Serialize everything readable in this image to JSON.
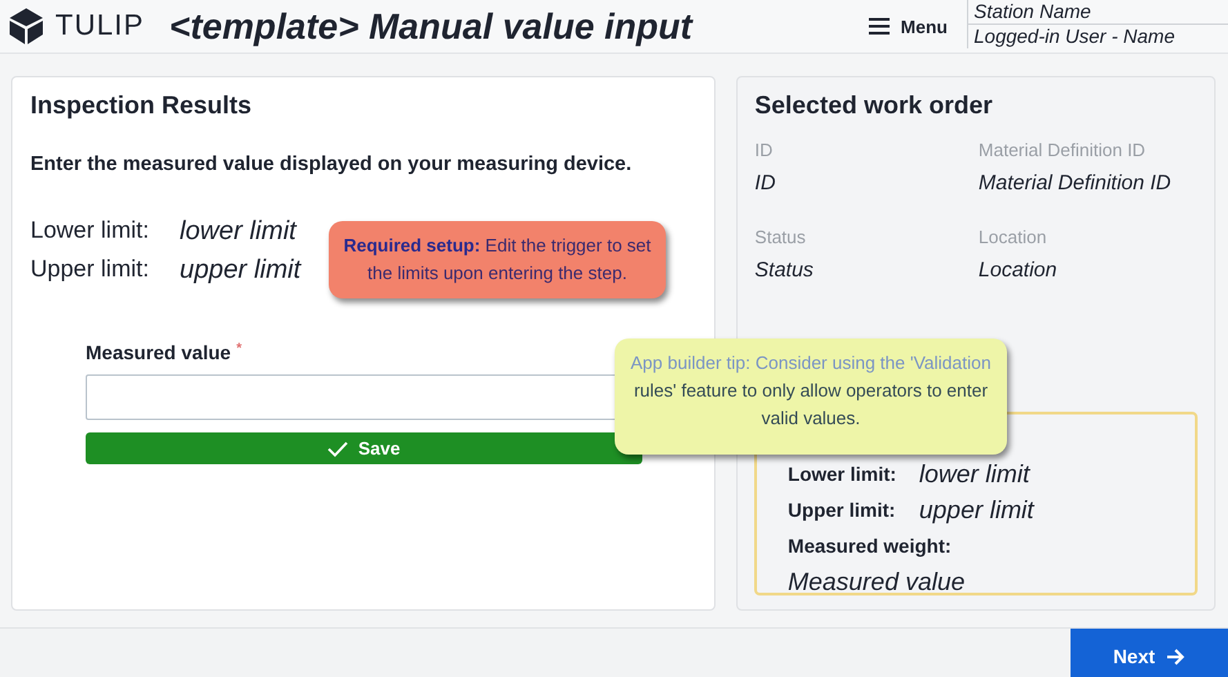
{
  "header": {
    "brand": "TULIP",
    "title": "<template> Manual value input",
    "menu": "Menu",
    "station": "Station Name",
    "user": "Logged-in User - Name"
  },
  "inspection": {
    "title": "Inspection Results",
    "instruction": "Enter the measured value displayed on your measuring device.",
    "limits": [
      {
        "label": "Lower limit:",
        "value": "lower limit"
      },
      {
        "label": "Upper limit:",
        "value": "upper limit"
      }
    ],
    "field": {
      "label": "Measured value",
      "required_mark": "*"
    },
    "save": "Save"
  },
  "notes": [
    {
      "kind": "required",
      "text": "**Required setup:** Edit the trigger to set the limits upon entering the step."
    },
    {
      "kind": "tip",
      "text": "**App builder tip: Consider using the 'Validation** rules' feature to only allow operators to enter valid values."
    }
  ],
  "work_order": {
    "title": "Selected work order",
    "fields": [
      {
        "label": "ID",
        "value": "ID"
      },
      {
        "label": "Material Definition ID",
        "value": "Material Definition ID"
      },
      {
        "label": "Status",
        "value": "Status"
      },
      {
        "label": "Location",
        "value": "Location"
      }
    ],
    "summary": [
      {
        "label": "Lower limit:",
        "value": "lower limit"
      },
      {
        "label": "Upper limit:",
        "value": "upper limit"
      },
      {
        "label": "Measured weight:",
        "value": "Measured value"
      }
    ]
  },
  "next": "Next"
}
